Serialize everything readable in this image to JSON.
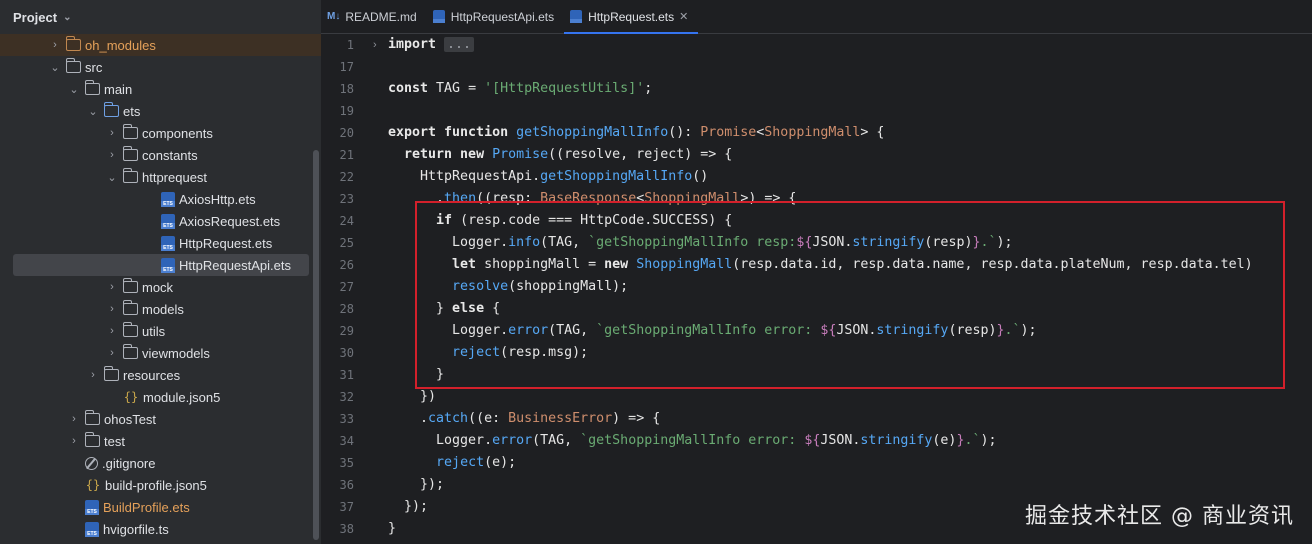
{
  "project": {
    "title": "Project",
    "tree": [
      {
        "label": "oh_modules",
        "indent": 3,
        "arrow": "›",
        "icon": "folder-orange",
        "style": "orange",
        "highlight": true
      },
      {
        "label": "src",
        "indent": 3,
        "arrow": "⌄",
        "icon": "folder"
      },
      {
        "label": "main",
        "indent": 4,
        "arrow": "⌄",
        "icon": "folder"
      },
      {
        "label": "ets",
        "indent": 5,
        "arrow": "⌄",
        "icon": "folder-blue"
      },
      {
        "label": "components",
        "indent": 6,
        "arrow": "›",
        "icon": "folder"
      },
      {
        "label": "constants",
        "indent": 6,
        "arrow": "›",
        "icon": "folder"
      },
      {
        "label": "httprequest",
        "indent": 6,
        "arrow": "⌄",
        "icon": "folder"
      },
      {
        "label": "AxiosHttp.ets",
        "indent": 8,
        "arrow": "",
        "icon": "ets"
      },
      {
        "label": "AxiosRequest.ets",
        "indent": 8,
        "arrow": "",
        "icon": "ets"
      },
      {
        "label": "HttpRequest.ets",
        "indent": 8,
        "arrow": "",
        "icon": "ets"
      },
      {
        "label": "HttpRequestApi.ets",
        "indent": 8,
        "arrow": "",
        "icon": "ets",
        "selected": true
      },
      {
        "label": "mock",
        "indent": 6,
        "arrow": "›",
        "icon": "folder"
      },
      {
        "label": "models",
        "indent": 6,
        "arrow": "›",
        "icon": "folder"
      },
      {
        "label": "utils",
        "indent": 6,
        "arrow": "›",
        "icon": "folder"
      },
      {
        "label": "viewmodels",
        "indent": 6,
        "arrow": "›",
        "icon": "folder"
      },
      {
        "label": "resources",
        "indent": 5,
        "arrow": "›",
        "icon": "folder"
      },
      {
        "label": "module.json5",
        "indent": 6,
        "arrow": "",
        "icon": "json"
      },
      {
        "label": "ohosTest",
        "indent": 4,
        "arrow": "›",
        "icon": "folder"
      },
      {
        "label": "test",
        "indent": 4,
        "arrow": "›",
        "icon": "folder"
      },
      {
        "label": ".gitignore",
        "indent": 4,
        "arrow": "",
        "icon": "ignore"
      },
      {
        "label": "build-profile.json5",
        "indent": 4,
        "arrow": "",
        "icon": "json"
      },
      {
        "label": "BuildProfile.ets",
        "indent": 4,
        "arrow": "",
        "icon": "ets",
        "style": "orange"
      },
      {
        "label": "hvigorfile.ts",
        "indent": 4,
        "arrow": "",
        "icon": "ets"
      }
    ]
  },
  "tabs": [
    {
      "label": "README.md",
      "icon": "md",
      "active": false
    },
    {
      "label": "HttpRequestApi.ets",
      "icon": "ets",
      "active": false
    },
    {
      "label": "HttpRequest.ets",
      "icon": "ets",
      "active": true,
      "closable": true
    }
  ],
  "editor": {
    "line_numbers": [
      "1",
      "17",
      "18",
      "19",
      "20",
      "21",
      "22",
      "23",
      "24",
      "25",
      "26",
      "27",
      "28",
      "29",
      "30",
      "31",
      "32",
      "33",
      "34",
      "35",
      "36",
      "37",
      "38"
    ],
    "lines": [
      [
        [
          "kwb",
          "import "
        ],
        [
          "folded",
          "..."
        ]
      ],
      [],
      [
        [
          "kwb",
          "const "
        ],
        [
          "plain",
          "TAG = "
        ],
        [
          "str",
          "'[HttpRequestUtils]'"
        ],
        [
          "plain",
          ";"
        ]
      ],
      [],
      [
        [
          "kwb",
          "export function "
        ],
        [
          "fn",
          "getShoppingMallInfo"
        ],
        [
          "plain",
          "(): "
        ],
        [
          "type",
          "Promise"
        ],
        [
          "plain",
          "<"
        ],
        [
          "type",
          "ShoppingMall"
        ],
        [
          "plain",
          "> {"
        ]
      ],
      [
        [
          "plain",
          "  "
        ],
        [
          "kwb",
          "return new "
        ],
        [
          "fn",
          "Promise"
        ],
        [
          "plain",
          "((resolve, reject) => {"
        ]
      ],
      [
        [
          "plain",
          "    HttpRequestApi."
        ],
        [
          "fn",
          "getShoppingMallInfo"
        ],
        [
          "plain",
          "()"
        ]
      ],
      [
        [
          "plain",
          "      ."
        ],
        [
          "fn",
          "then"
        ],
        [
          "plain",
          "(("
        ],
        [
          "plain",
          "resp"
        ],
        [
          "plain",
          ": "
        ],
        [
          "type",
          "BaseResponse"
        ],
        [
          "plain",
          "<"
        ],
        [
          "type",
          "ShoppingMall"
        ],
        [
          "plain",
          ">) => {"
        ]
      ],
      [
        [
          "plain",
          "      "
        ],
        [
          "kwb",
          "if "
        ],
        [
          "plain",
          "(resp.code === HttpCode.SUCCESS) {"
        ]
      ],
      [
        [
          "plain",
          "        Logger."
        ],
        [
          "fn",
          "info"
        ],
        [
          "plain",
          "(TAG, "
        ],
        [
          "str",
          "`getShoppingMallInfo resp:"
        ],
        [
          "tmpl",
          "${"
        ],
        [
          "plain",
          "JSON."
        ],
        [
          "fn",
          "stringify"
        ],
        [
          "plain",
          "(resp)"
        ],
        [
          "tmpl",
          "}"
        ],
        [
          "str",
          ".`"
        ],
        [
          "plain",
          ");"
        ]
      ],
      [
        [
          "plain",
          "        "
        ],
        [
          "kwb",
          "let "
        ],
        [
          "plain",
          "shoppingMall = "
        ],
        [
          "kwb",
          "new "
        ],
        [
          "fn",
          "ShoppingMall"
        ],
        [
          "plain",
          "(resp.data.id, resp.data.name, resp.data.plateNum, resp.data.tel)"
        ]
      ],
      [
        [
          "plain",
          "        "
        ],
        [
          "fn",
          "resolve"
        ],
        [
          "plain",
          "(shoppingMall);"
        ]
      ],
      [
        [
          "plain",
          "      } "
        ],
        [
          "kwb",
          "else "
        ],
        [
          "plain",
          "{"
        ]
      ],
      [
        [
          "plain",
          "        Logger."
        ],
        [
          "fn",
          "error"
        ],
        [
          "plain",
          "(TAG, "
        ],
        [
          "str",
          "`getShoppingMallInfo error: "
        ],
        [
          "tmpl",
          "${"
        ],
        [
          "plain",
          "JSON."
        ],
        [
          "fn",
          "stringify"
        ],
        [
          "plain",
          "(resp)"
        ],
        [
          "tmpl",
          "}"
        ],
        [
          "str",
          ".`"
        ],
        [
          "plain",
          ");"
        ]
      ],
      [
        [
          "plain",
          "        "
        ],
        [
          "fn",
          "reject"
        ],
        [
          "plain",
          "(resp.msg);"
        ]
      ],
      [
        [
          "plain",
          "      }"
        ]
      ],
      [
        [
          "plain",
          "    })"
        ]
      ],
      [
        [
          "plain",
          "    ."
        ],
        [
          "fn",
          "catch"
        ],
        [
          "plain",
          "((e: "
        ],
        [
          "type",
          "BusinessError"
        ],
        [
          "plain",
          ") => {"
        ]
      ],
      [
        [
          "plain",
          "      Logger."
        ],
        [
          "fn",
          "error"
        ],
        [
          "plain",
          "(TAG, "
        ],
        [
          "str",
          "`getShoppingMallInfo error: "
        ],
        [
          "tmpl",
          "${"
        ],
        [
          "plain",
          "JSON."
        ],
        [
          "fn",
          "stringify"
        ],
        [
          "plain",
          "(e)"
        ],
        [
          "tmpl",
          "}"
        ],
        [
          "str",
          ".`"
        ],
        [
          "plain",
          ");"
        ]
      ],
      [
        [
          "plain",
          "      "
        ],
        [
          "fn",
          "reject"
        ],
        [
          "plain",
          "(e);"
        ]
      ],
      [
        [
          "plain",
          "    });"
        ]
      ],
      [
        [
          "plain",
          "  });"
        ]
      ],
      [
        [
          "plain",
          "}"
        ]
      ]
    ]
  },
  "watermark": "掘金技术社区 @ 商业资讯",
  "colors": {
    "highlight_box": "#d3202b",
    "active_tab_underline": "#3574f0"
  }
}
